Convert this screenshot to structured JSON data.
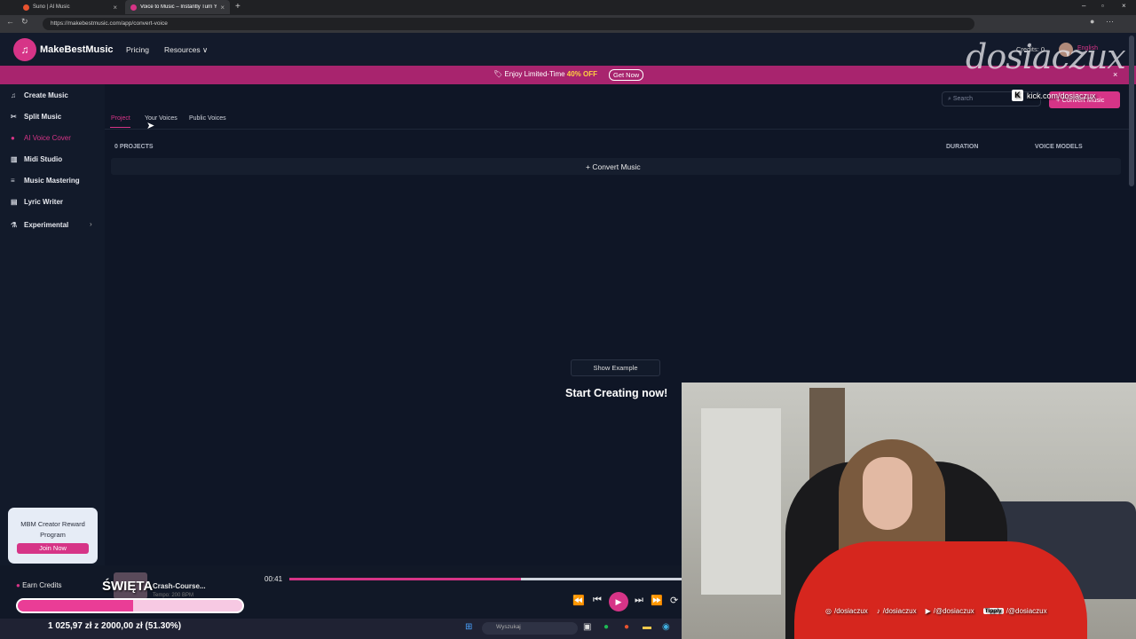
{
  "browser": {
    "tabs": [
      {
        "title": "Suno | AI Music",
        "fav_color": "#e8532f"
      },
      {
        "title": "Voice to Music – Instantly Turn Yo",
        "fav_color": "#d63487"
      }
    ],
    "url": "https://makebestmusic.com/app/convert-voice"
  },
  "site": {
    "brand": "MakeBestMusic",
    "nav": {
      "pricing": "Pricing",
      "resources": "Resources"
    },
    "credits": "Credits: 0",
    "lang": "English",
    "accent": "#d63487"
  },
  "promo": {
    "pre": "Enjoy Limited-Time ",
    "off": "40% OFF",
    "button": "Get Now"
  },
  "sidebar": {
    "items": [
      {
        "label": "Create Music",
        "icon": "music-note-icon"
      },
      {
        "label": "Split Music",
        "icon": "split-icon"
      },
      {
        "label": "AI Voice Cover",
        "icon": "mic-icon"
      },
      {
        "label": "Midi Studio",
        "icon": "piano-icon"
      },
      {
        "label": "Music Mastering",
        "icon": "equalizer-icon"
      },
      {
        "label": "Lyric Writer",
        "icon": "document-icon"
      },
      {
        "label": "Experimental",
        "icon": "flask-icon"
      }
    ],
    "active_index": 2,
    "reward": {
      "title": "MBM Creator Reward Program",
      "button": "Join Now"
    },
    "earn": "Earn Credits"
  },
  "main": {
    "search_placeholder": "Search",
    "convert_button": "Convert Music",
    "tabs": [
      "Project",
      "Your Voices",
      "Public Voices"
    ],
    "selected_tab": 0,
    "columns": {
      "projects": "0 PROJECTS",
      "duration": "DURATION",
      "voice_models": "VOICE MODELS"
    },
    "convert_row": "Convert Music",
    "show_example": "Show Example",
    "start_text": "Start Creating now!"
  },
  "player": {
    "track": "Crash-Course...",
    "track_sub": "Tempo: 200 BPM",
    "time": "00:41",
    "progress": 0.59
  },
  "stream": {
    "title_overlay": "ŚWIĘTA",
    "goal_text": "1 025,97 zł z 2000,00 zł (51.30%)",
    "goal_fraction": 0.513,
    "watermark": "dosiaczux",
    "kick": "kick.com/dosiaczux",
    "socials": [
      {
        "icon": "instagram-icon",
        "text": "/dosiaczux"
      },
      {
        "icon": "tiktok-icon",
        "text": "/dosiaczux"
      },
      {
        "icon": "youtube-icon",
        "text": "/@dosiaczux"
      },
      {
        "badge": "Tipply",
        "text": "/@dosiaczux"
      }
    ],
    "taskbar_search": "Wyszukaj"
  }
}
